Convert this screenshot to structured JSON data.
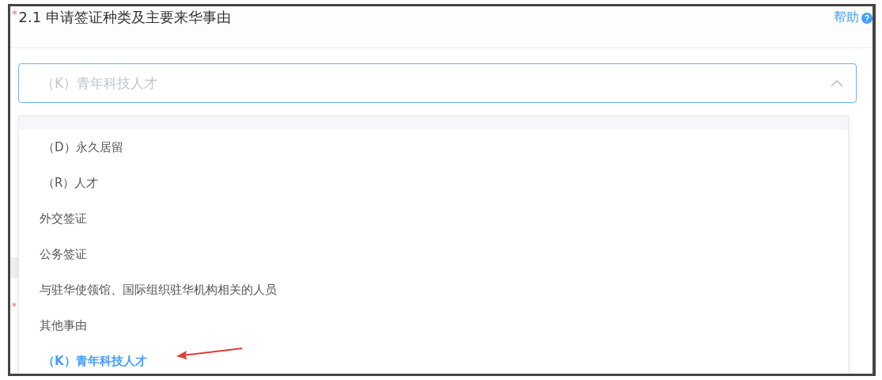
{
  "section": {
    "required_mark": "*",
    "title": "2.1 申请签证种类及主要来华事由",
    "help": "帮助"
  },
  "select": {
    "value": "（K）青年科技人才",
    "expanded": true
  },
  "options": [
    {
      "kind": "sub",
      "label": "（D）永久居留",
      "selected": false
    },
    {
      "kind": "sub",
      "label": "（R）人才",
      "selected": false
    },
    {
      "kind": "main",
      "label": "外交签证",
      "selected": false
    },
    {
      "kind": "main",
      "label": "公务签证",
      "selected": false
    },
    {
      "kind": "main",
      "label": "与驻华使领馆、国际组织驻华机构相关的人员",
      "selected": false
    },
    {
      "kind": "main",
      "label": "其他事由",
      "selected": false
    },
    {
      "kind": "sub",
      "label": "（K）青年科技人才",
      "selected": true
    }
  ],
  "next_field": {
    "required_mark": "*"
  }
}
